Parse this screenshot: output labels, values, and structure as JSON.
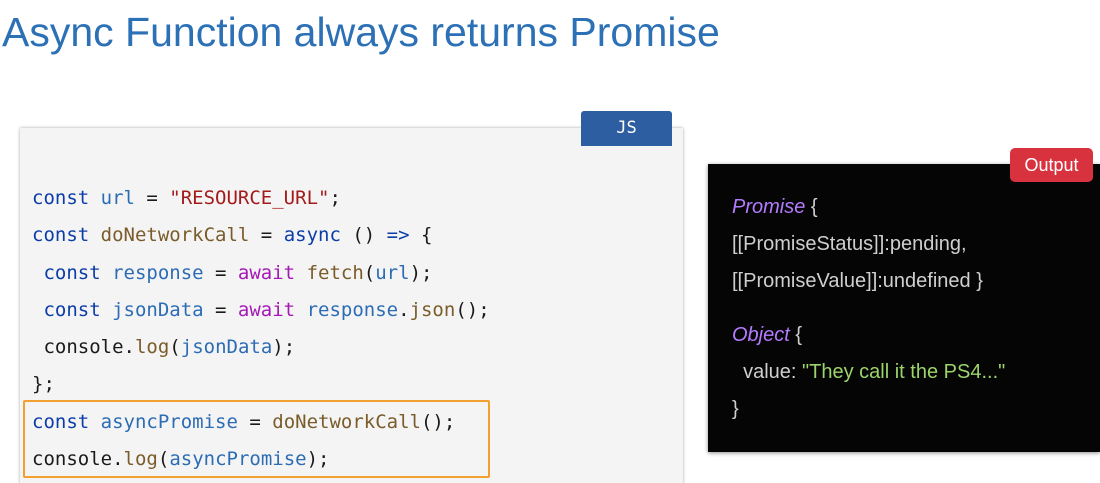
{
  "slide": {
    "title": "Async Function always returns Promise"
  },
  "code_panel": {
    "language_badge": "JS",
    "lines": [
      [
        {
          "t": "const ",
          "c": "kw"
        },
        {
          "t": "url",
          "c": "var"
        },
        {
          "t": " = ",
          "c": "pl"
        },
        {
          "t": "\"RESOURCE_URL\"",
          "c": "str"
        },
        {
          "t": ";",
          "c": "pl"
        }
      ],
      [
        {
          "t": "const ",
          "c": "kw"
        },
        {
          "t": "doNetworkCall",
          "c": "fn"
        },
        {
          "t": " = ",
          "c": "pl"
        },
        {
          "t": "async",
          "c": "kw"
        },
        {
          "t": " () ",
          "c": "pl"
        },
        {
          "t": "=>",
          "c": "kw"
        },
        {
          "t": " {",
          "c": "pl"
        }
      ],
      [
        {
          "t": " const ",
          "c": "kw"
        },
        {
          "t": "response",
          "c": "var"
        },
        {
          "t": " = ",
          "c": "pl"
        },
        {
          "t": "await",
          "c": "aw"
        },
        {
          "t": " ",
          "c": "pl"
        },
        {
          "t": "fetch",
          "c": "fn"
        },
        {
          "t": "(",
          "c": "pl"
        },
        {
          "t": "url",
          "c": "var"
        },
        {
          "t": ");",
          "c": "pl"
        }
      ],
      [
        {
          "t": " const ",
          "c": "kw"
        },
        {
          "t": "jsonData",
          "c": "var"
        },
        {
          "t": " = ",
          "c": "pl"
        },
        {
          "t": "await",
          "c": "aw"
        },
        {
          "t": " ",
          "c": "pl"
        },
        {
          "t": "response",
          "c": "var"
        },
        {
          "t": ".",
          "c": "pl"
        },
        {
          "t": "json",
          "c": "fn"
        },
        {
          "t": "();",
          "c": "pl"
        }
      ],
      [
        {
          "t": " console",
          "c": "pl"
        },
        {
          "t": ".",
          "c": "pl"
        },
        {
          "t": "log",
          "c": "fn"
        },
        {
          "t": "(",
          "c": "pl"
        },
        {
          "t": "jsonData",
          "c": "var"
        },
        {
          "t": ");",
          "c": "pl"
        }
      ],
      [
        {
          "t": "};",
          "c": "pl"
        }
      ],
      [
        {
          "t": "const ",
          "c": "kw"
        },
        {
          "t": "asyncPromise",
          "c": "var"
        },
        {
          "t": " = ",
          "c": "pl"
        },
        {
          "t": "doNetworkCall",
          "c": "fn"
        },
        {
          "t": "();",
          "c": "pl"
        }
      ],
      [
        {
          "t": "console",
          "c": "pl"
        },
        {
          "t": ".",
          "c": "pl"
        },
        {
          "t": "log",
          "c": "fn"
        },
        {
          "t": "(",
          "c": "pl"
        },
        {
          "t": "asyncPromise",
          "c": "var"
        },
        {
          "t": ");",
          "c": "pl"
        }
      ]
    ],
    "highlighted_line_range": [
      7,
      8
    ]
  },
  "output_panel": {
    "badge": "Output",
    "promise_type": "Promise",
    "promise_open": " {",
    "promise_status": "[[PromiseStatus]]:pending,",
    "promise_value": "[[PromiseValue]]:undefined }",
    "object_type": "Object",
    "object_open": " {",
    "object_key": "  value: ",
    "object_value": "\"They call it the PS4...\"",
    "object_close": "}"
  },
  "colors": {
    "title": "#2c70b5",
    "js_badge": "#2c5ea1",
    "output_badge": "#d8323f",
    "highlight_border": "#f2a030",
    "keyword": "#0b3da8",
    "variable": "#2c6cb4",
    "string": "#a31a1a",
    "await": "#a419b5",
    "function": "#7a5c2a",
    "output_type": "#b57bff",
    "output_string": "#9cd46a"
  }
}
